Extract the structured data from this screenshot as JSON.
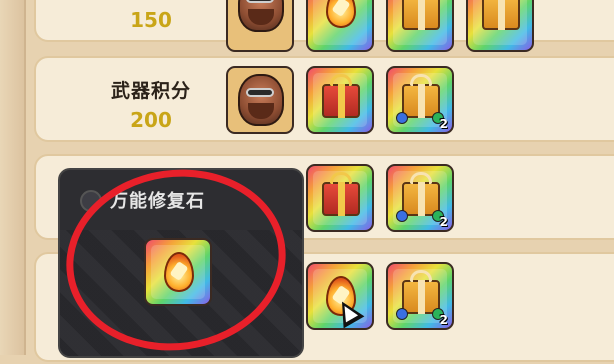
{
  "rows": [
    {
      "label": "",
      "score": "150"
    },
    {
      "label": "武器积分",
      "score": "200",
      "items": [
        {
          "count": ""
        },
        {
          "count": "2"
        }
      ]
    },
    {
      "items": [
        {
          "count": ""
        },
        {
          "count": "2"
        }
      ]
    },
    {
      "items": [
        {
          "count": ""
        },
        {
          "count": "2"
        }
      ]
    }
  ],
  "popup": {
    "title": "万能修复石",
    "item_icon": "flame-coin-icon"
  },
  "annotation": {
    "color": "#e8202a",
    "shape": "hand-drawn-circle"
  },
  "colors": {
    "background": "#e7d2b0",
    "row_background": "#f6ecd8",
    "score": "#c9a517",
    "popup_background": "#2d2d31"
  }
}
